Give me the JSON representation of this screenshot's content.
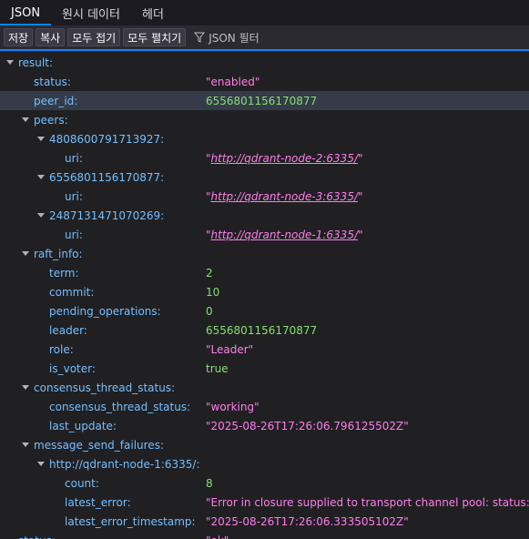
{
  "tabs": [
    {
      "label": "JSON",
      "active": true
    },
    {
      "label": "원시 데이터",
      "active": false
    },
    {
      "label": "헤더",
      "active": false
    }
  ],
  "toolbar": {
    "save": "저장",
    "copy": "복사",
    "collapse_all": "모두 접기",
    "expand_all": "모두 펼치기",
    "filter_placeholder": "JSON 필터"
  },
  "rows": [
    {
      "key": "result:",
      "indent": 0,
      "twisty": true
    },
    {
      "key": "status:",
      "indent": 1,
      "value": "\"enabled\"",
      "type": "str"
    },
    {
      "key": "peer_id:",
      "indent": 1,
      "value": "6556801156170877",
      "type": "num",
      "selected": true
    },
    {
      "key": "peers:",
      "indent": 1,
      "twisty": true
    },
    {
      "key": "4808600791713927:",
      "indent": 2,
      "twisty": true
    },
    {
      "key": "uri:",
      "indent": 3,
      "value": "\"http://qdrant-node-2:6335/\"",
      "type": "url"
    },
    {
      "key": "6556801156170877:",
      "indent": 2,
      "twisty": true
    },
    {
      "key": "uri:",
      "indent": 3,
      "value": "\"http://qdrant-node-3:6335/\"",
      "type": "url"
    },
    {
      "key": "2487131471070269:",
      "indent": 2,
      "twisty": true
    },
    {
      "key": "uri:",
      "indent": 3,
      "value": "\"http://qdrant-node-1:6335/\"",
      "type": "url"
    },
    {
      "key": "raft_info:",
      "indent": 1,
      "twisty": true
    },
    {
      "key": "term:",
      "indent": 2,
      "value": "2",
      "type": "num"
    },
    {
      "key": "commit:",
      "indent": 2,
      "value": "10",
      "type": "num"
    },
    {
      "key": "pending_operations:",
      "indent": 2,
      "value": "0",
      "type": "num"
    },
    {
      "key": "leader:",
      "indent": 2,
      "value": "6556801156170877",
      "type": "num"
    },
    {
      "key": "role:",
      "indent": 2,
      "value": "\"Leader\"",
      "type": "str"
    },
    {
      "key": "is_voter:",
      "indent": 2,
      "value": "true",
      "type": "bool"
    },
    {
      "key": "consensus_thread_status:",
      "indent": 1,
      "twisty": true
    },
    {
      "key": "consensus_thread_status:",
      "indent": 2,
      "value": "\"working\"",
      "type": "str"
    },
    {
      "key": "last_update:",
      "indent": 2,
      "value": "\"2025-08-26T17:26:06.796125502Z\"",
      "type": "str"
    },
    {
      "key": "message_send_failures:",
      "indent": 1,
      "twisty": true
    },
    {
      "key": "http://qdrant-node-1:6335/:",
      "indent": 2,
      "twisty": true
    },
    {
      "key": "count:",
      "indent": 3,
      "value": "8",
      "type": "num"
    },
    {
      "key": "latest_error:",
      "indent": 3,
      "value": "\"Error in closure supplied to transport channel pool: status: Unava",
      "type": "str"
    },
    {
      "key": "latest_error_timestamp:",
      "indent": 3,
      "value": "\"2025-08-26T17:26:06.333505102Z\"",
      "type": "str"
    },
    {
      "key": "status:",
      "indent": 0,
      "value": "\"ok\"",
      "type": "str"
    }
  ],
  "colors": {
    "accent": "#0a84ff",
    "key": "#75bfff",
    "string": "#ff7de9",
    "number": "#86de74",
    "background": "#202023"
  },
  "icons": {
    "filter": "funnel-icon",
    "twisty": "chevron-down-icon"
  }
}
